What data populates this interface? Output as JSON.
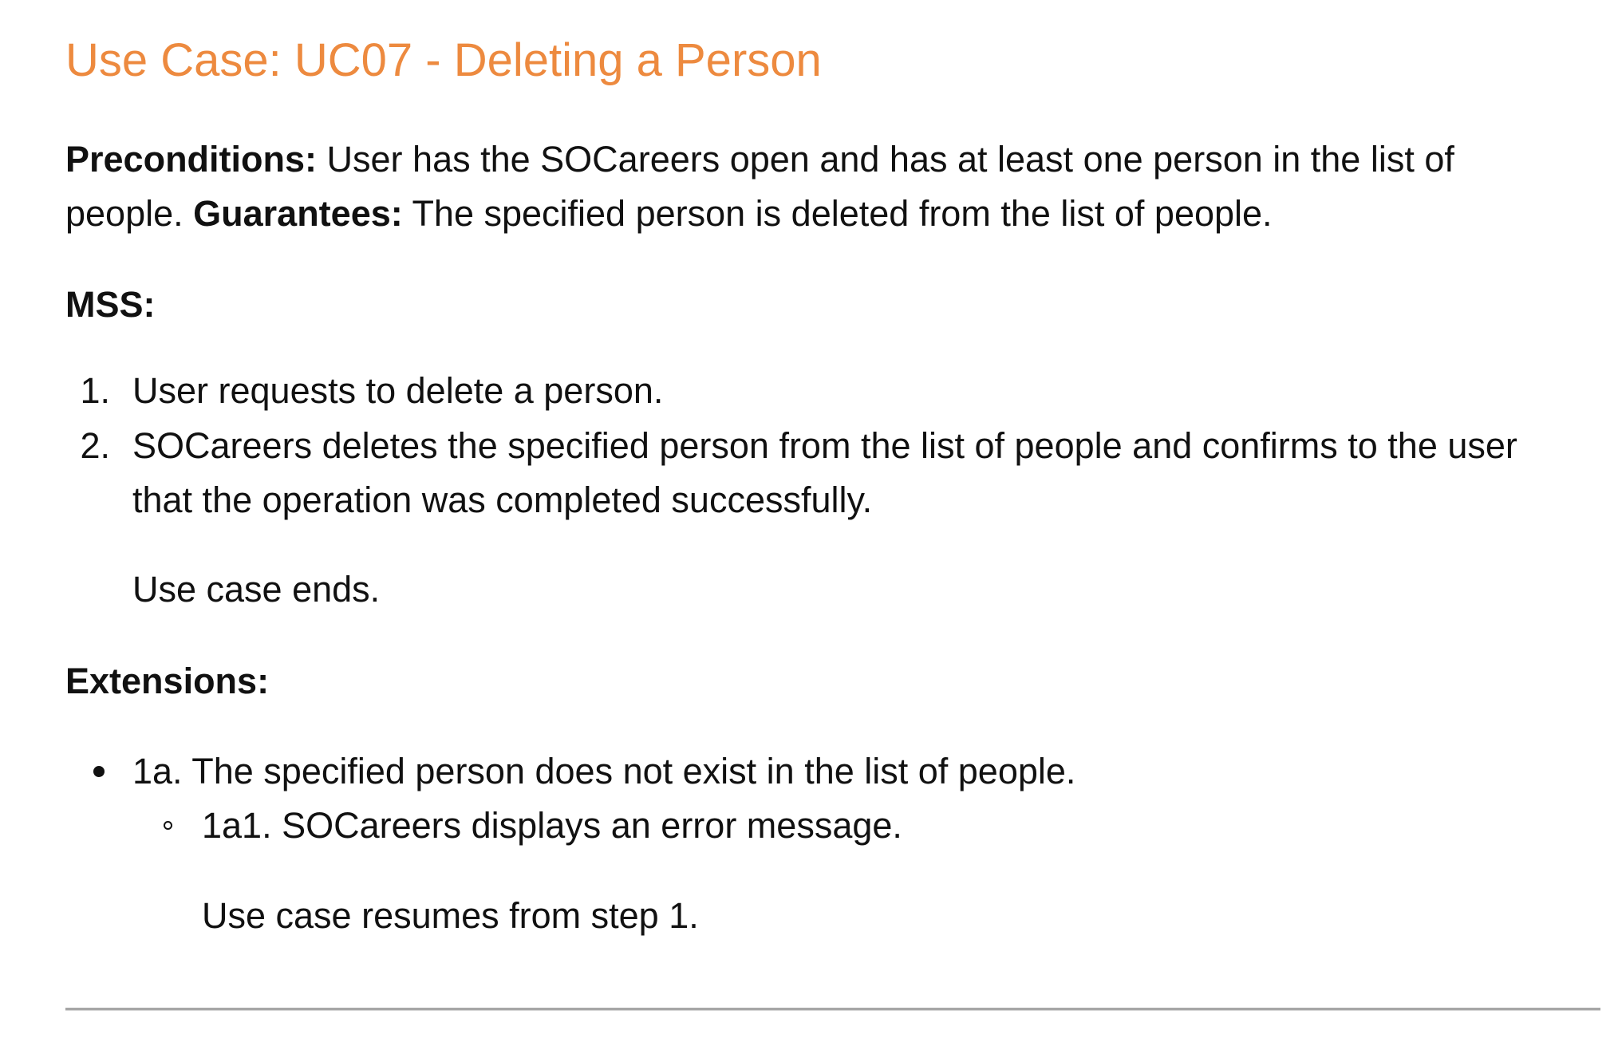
{
  "title": "Use Case: UC07 - Deleting a Person",
  "accent_color": "#ED8A3F",
  "preconditions": {
    "label": "Preconditions:",
    "text_line1": " User has the SOCareers open and has at least one person in the list of",
    "text_line2_start": "people. ",
    "guarantees_label": "Guarantees:",
    "guarantees_text": " The specified person is deleted from the list of people."
  },
  "mss": {
    "heading": "MSS:",
    "steps": [
      {
        "marker": "1.",
        "text": "User requests to delete a person."
      },
      {
        "marker": "2.",
        "line1": "SOCareers deletes the specified person from the list of people and confirms to the user",
        "line2": "that the operation was completed successfully."
      }
    ],
    "ending": "Use case ends."
  },
  "extensions": {
    "heading": "Extensions:",
    "items": [
      {
        "text": "1a. The specified person does not exist in the list of people.",
        "sub_items": [
          {
            "text": "1a1. SOCareers displays an error message."
          }
        ],
        "ending": "Use case resumes from step 1."
      }
    ]
  }
}
